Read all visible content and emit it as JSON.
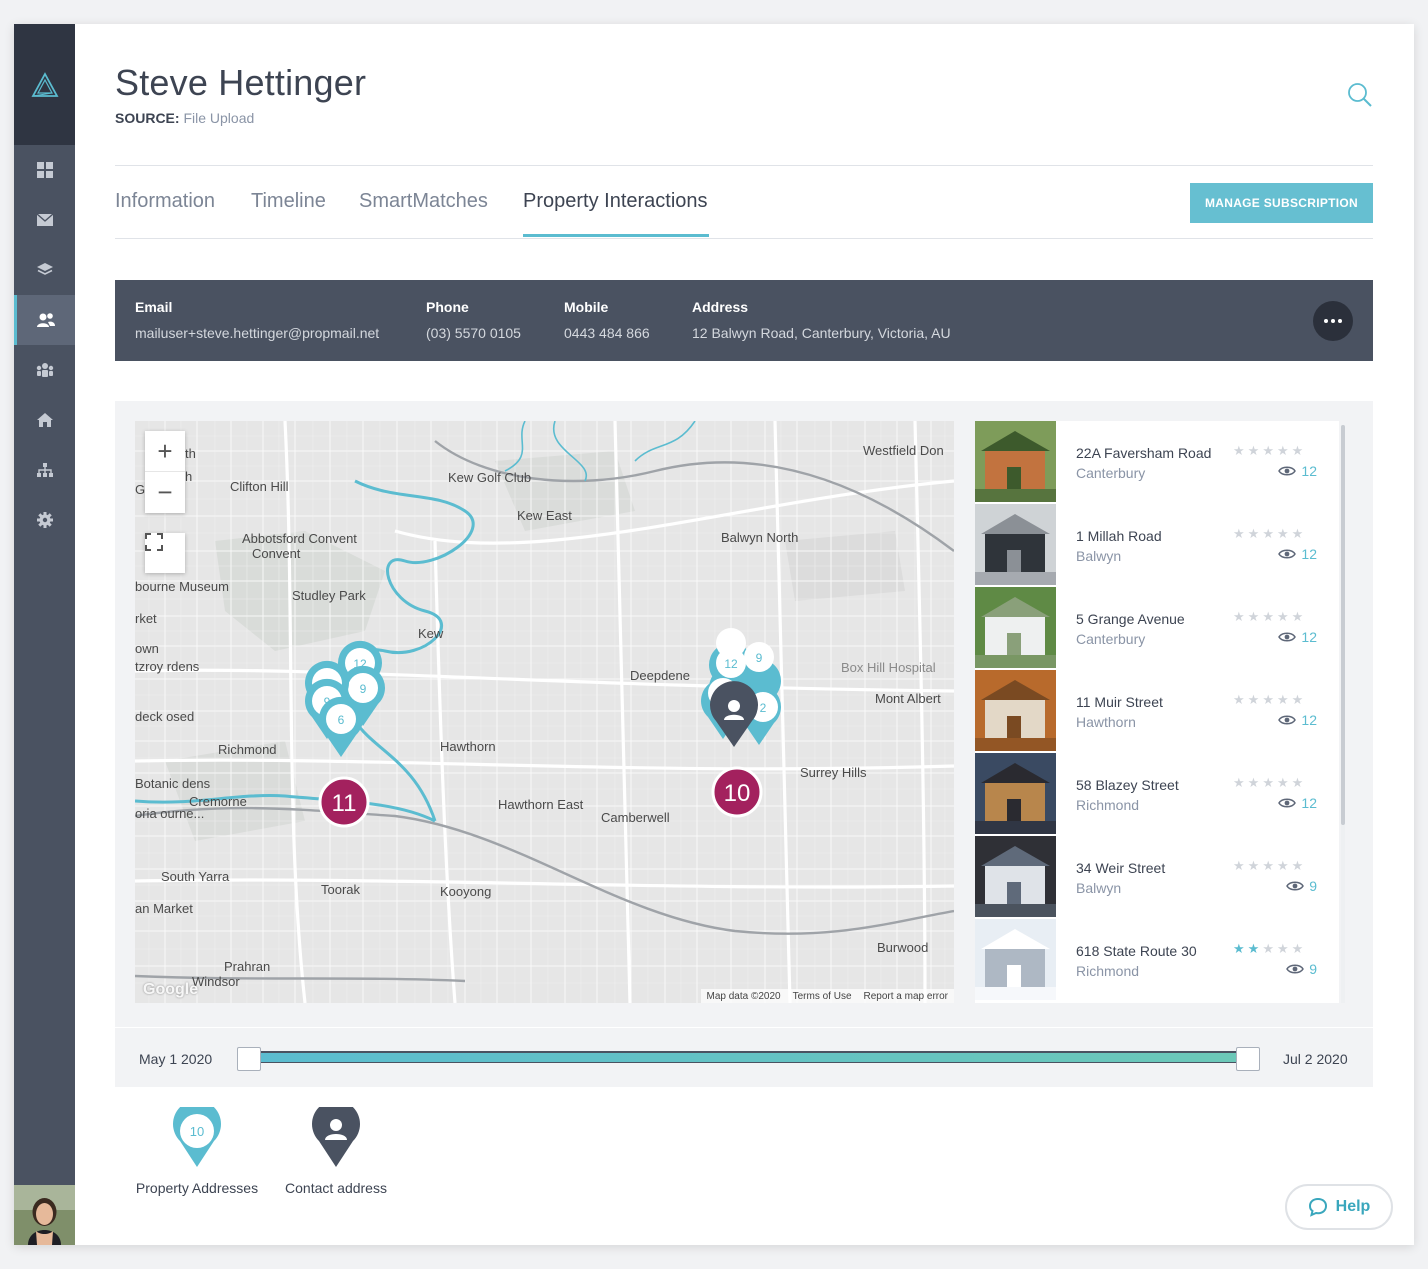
{
  "contact": {
    "name": "Steve Hettinger",
    "source_label": "SOURCE:",
    "source_value": "File Upload"
  },
  "tabs": [
    {
      "label": "Information"
    },
    {
      "label": "Timeline"
    },
    {
      "label": "SmartMatches"
    },
    {
      "label": "Property Interactions"
    }
  ],
  "manage_button": "MANAGE SUBSCRIPTION",
  "details": {
    "email_label": "Email",
    "email": "mailuser+steve.hettinger@propmail.net",
    "phone_label": "Phone",
    "phone": "(03) 5570 0105",
    "mobile_label": "Mobile",
    "mobile": "0443 484 866",
    "address_label": "Address",
    "address": "12 Balwyn Road, Canterbury, Victoria, AU"
  },
  "map": {
    "places": [
      "Clifton Hill",
      "Kew Golf Club",
      "Kew East",
      "Balwyn North",
      "Westfield Don",
      "Abbotsford Convent",
      "Studley Park",
      "bourne Museum",
      "Kew",
      "Deepdene",
      "Box Hill Hospital",
      "Mont Albert",
      "Richmond",
      "Hawthorn",
      "Surrey Hills",
      "Cremorne",
      "Hawthorn East",
      "Camberwell",
      "South Yarra",
      "Toorak",
      "Kooyong",
      "Burwood",
      "Prahran",
      "Windsor",
      "Botanic dens",
      "deck osed",
      "rket",
      "own",
      "tzroy rdens",
      "an Market",
      "oria ourne...",
      "th",
      "h",
      "G"
    ],
    "cluster_a": "11",
    "cluster_b": "10",
    "pins": [
      "12",
      "9",
      "9",
      "6",
      "6",
      "12",
      "9",
      "2",
      "1"
    ],
    "google": "Google",
    "footer": [
      "Map data ©2020",
      "Terms of Use",
      "Report a map error"
    ],
    "zoom_in": "+",
    "zoom_out": "−"
  },
  "properties": [
    {
      "street": "22A Faversham Road",
      "suburb": "Canterbury",
      "rating": 0,
      "views": "12"
    },
    {
      "street": "1 Millah Road",
      "suburb": "Balwyn",
      "rating": 0,
      "views": "12"
    },
    {
      "street": "5 Grange Avenue",
      "suburb": "Canterbury",
      "rating": 0,
      "views": "12"
    },
    {
      "street": "11 Muir Street",
      "suburb": "Hawthorn",
      "rating": 0,
      "views": "12"
    },
    {
      "street": "58 Blazey Street",
      "suburb": "Richmond",
      "rating": 0,
      "views": "12"
    },
    {
      "street": "34 Weir Street",
      "suburb": "Balwyn",
      "rating": 0,
      "views": "9"
    },
    {
      "street": "618 State Route 30",
      "suburb": "Richmond",
      "rating": 2,
      "views": "9"
    }
  ],
  "timeline": {
    "start": "May 1 2020",
    "end": "Jul 2 2020"
  },
  "legend": {
    "property_pin": "10",
    "property_label": "Property Addresses",
    "contact_label": "Contact address"
  },
  "help": "Help",
  "colors": {
    "accent": "#5bbcd0",
    "dark": "#4a5261",
    "cluster": "#a3215e"
  }
}
